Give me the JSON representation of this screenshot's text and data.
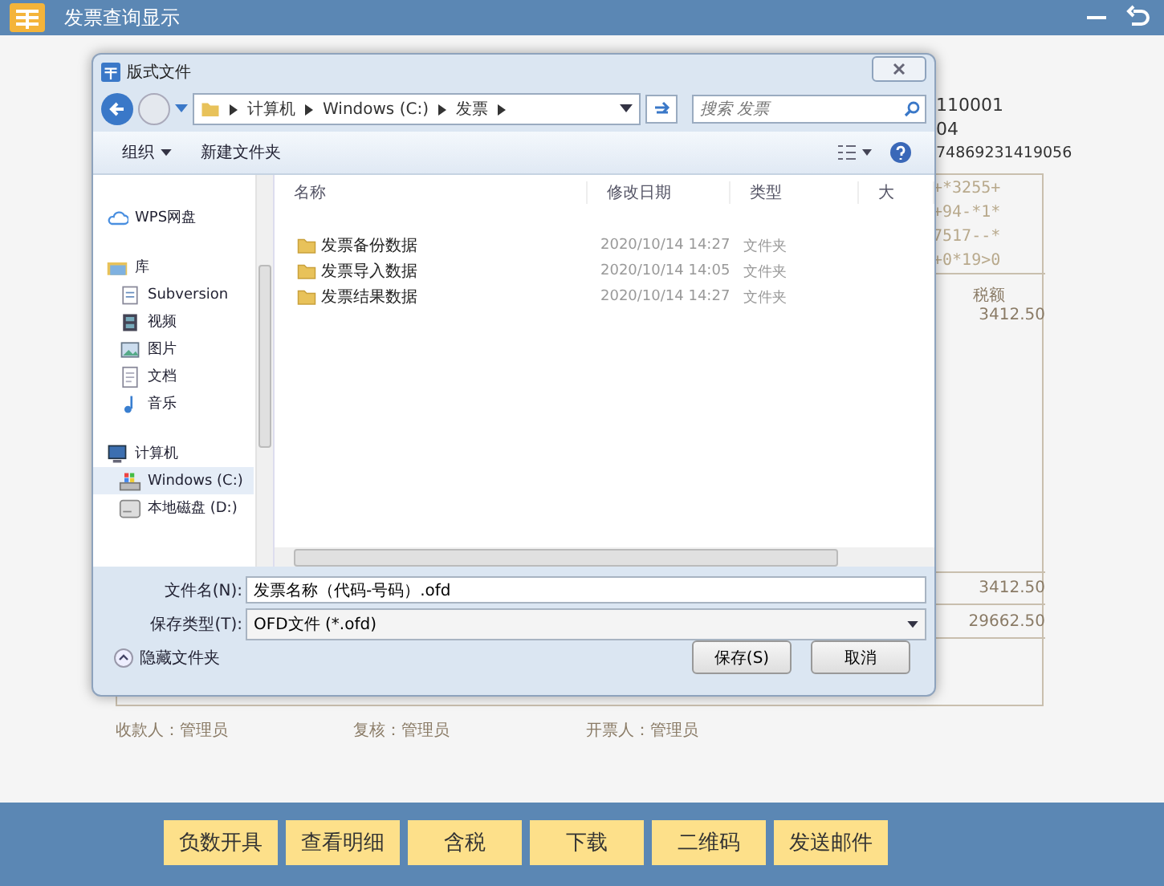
{
  "window": {
    "title": "发票查询显示"
  },
  "invoice": {
    "header_lines": [
      "110001",
      "04",
      "74869231419056"
    ],
    "cipher_lines": [
      "+*3255+",
      "+94-*1*",
      "7517--*",
      "+0*19>0"
    ],
    "tax_label": "税额",
    "tax_amount": "3412.50",
    "total_tax": "3412.50",
    "total_with_tax": "29662.50",
    "signers": [
      "收款人：管理员",
      "复核：管理员",
      "开票人：管理员"
    ]
  },
  "dialog": {
    "title": "版式文件",
    "path": [
      "计算机",
      "Windows (C:)",
      "发票"
    ],
    "search": {
      "placeholder": "搜索 发票"
    },
    "organize": "组织",
    "new_folder": "新建文件夹",
    "nav": [
      {
        "label": "WPS网盘",
        "kind": "cloud",
        "selected": false
      },
      {
        "label": "库",
        "kind": "library",
        "selected": false,
        "children": [
          {
            "label": "Subversion",
            "kind": "svn",
            "selected": false
          },
          {
            "label": "视频",
            "kind": "video",
            "selected": false
          },
          {
            "label": "图片",
            "kind": "picture",
            "selected": false
          },
          {
            "label": "文档",
            "kind": "document",
            "selected": false
          },
          {
            "label": "音乐",
            "kind": "music",
            "selected": false
          }
        ]
      },
      {
        "label": "计算机",
        "kind": "computer",
        "selected": false,
        "children": [
          {
            "label": "Windows (C:)",
            "kind": "system-drive",
            "selected": true
          },
          {
            "label": "本地磁盘 (D:)",
            "kind": "drive",
            "selected": false
          }
        ]
      }
    ],
    "columns": [
      "名称",
      "修改日期",
      "类型",
      "大"
    ],
    "files": [
      {
        "name": "发票备份数据",
        "date": "2020/10/14 14:27",
        "type": "文件夹"
      },
      {
        "name": "发票导入数据",
        "date": "2020/10/14 14:05",
        "type": "文件夹"
      },
      {
        "name": "发票结果数据",
        "date": "2020/10/14 14:27",
        "type": "文件夹"
      }
    ],
    "file_name": {
      "label": "文件名(N):",
      "value": "发票名称（代码-号码）.ofd"
    },
    "save_type": {
      "label": "保存类型(T):",
      "value": "OFD文件 (*.ofd)"
    },
    "hide_folders": "隐藏文件夹",
    "buttons": [
      "保存(S)",
      "取消"
    ]
  },
  "actions": [
    "负数开具",
    "查看明细",
    "含税",
    "下载",
    "二维码",
    "发送邮件"
  ]
}
